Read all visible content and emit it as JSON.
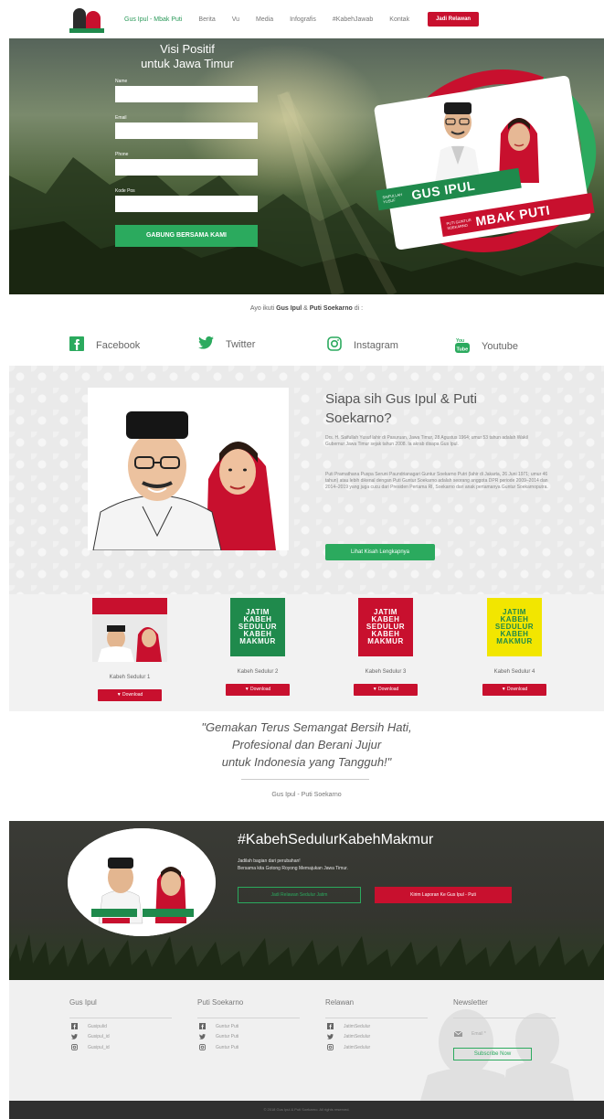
{
  "nav": {
    "brand": "Gus Ipul - Mbak Puti",
    "links": [
      "Berita",
      "Vu",
      "Media",
      "Infografis",
      "#KabehJawab",
      "Kontak"
    ],
    "cta": "Jadi Relawan"
  },
  "hero": {
    "title_line1": "Visi Positif",
    "title_line2": "untuk Jawa Timur",
    "form": {
      "name_label": "Name",
      "email_label": "Email",
      "phone_label": "Phone",
      "zip_label": "Kode Pos",
      "submit": "GABUNG BERSAMA KAMI"
    },
    "campaign": {
      "badge1_small": "SAIFULLAH YUSUF",
      "badge1_big": "GUS IPUL",
      "badge2_small": "PUTI GUNTUR SOEKARNO",
      "badge2_big": "MBAK PUTI"
    }
  },
  "follow": {
    "prefix": "Ayo ikuti",
    "name1": "Gus Ipul",
    "amp": "&",
    "name2": "Puti Soekarno",
    "suffix": "di :",
    "networks": [
      {
        "label": "Facebook",
        "icon": "facebook-icon"
      },
      {
        "label": "Twitter",
        "icon": "twitter-icon"
      },
      {
        "label": "Instagram",
        "icon": "instagram-icon"
      },
      {
        "label": "Youtube",
        "icon": "youtube-icon"
      }
    ]
  },
  "about": {
    "title": "Siapa sih Gus Ipul & Puti Soekarno?",
    "p1": "Drs. H. Saifullah Yusuf lahir di Pasuruan, Jawa Timur, 28 Agustus 1964; umur 53 tahun adalah Wakil Gubernur Jawa Timur sejak tahun 2008. Ia akrab disapa Gus Ipul.",
    "p2": "Puti Pramathana Puspa Seruni Paundrianagari Guntur Soekarno Putri (lahir di Jakarta, 26 Juni 1971; umur 46 tahun) atau lebih dikenal dengan Puti Guntur Soekarno adalah seorang anggota DPR periode 2009–2014 dan 2014–2019 yang juga cucu dari Presiden Pertama RI, Soekarno dari anak pertamanya Guntur Soekarnoputra.",
    "button": "Lihat Kisah Lengkapnya"
  },
  "downloads": {
    "items": [
      {
        "title": "Kabeh Sedulur 1",
        "poster_lines": []
      },
      {
        "title": "Kabeh Sedulur 2",
        "poster_lines": [
          "JATIM",
          "KABEH",
          "SEDULUR",
          "KABEH",
          "MAKMUR"
        ]
      },
      {
        "title": "Kabeh Sedulur 3",
        "poster_lines": [
          "JATIM",
          "KABEH",
          "SEDULUR",
          "KABEH",
          "MAKMUR"
        ]
      },
      {
        "title": "Kabeh Sedulur 4",
        "poster_lines": [
          "JATIM",
          "KABEH",
          "SEDULUR",
          "KABEH",
          "MAKMUR"
        ]
      }
    ],
    "button": "Download"
  },
  "quote": {
    "line1": "\"Gemakan Terus Semangat Bersih Hati,",
    "line2": "Profesional dan Berani Jujur",
    "line3": "untuk Indonesia yang Tangguh!\"",
    "author": "Gus Ipul - Puti Soekarno"
  },
  "band": {
    "title": "#KabehSedulurKabehMakmur",
    "p1": "Jadilah bagian dari perubahan!",
    "p2": "Bersama kita Gotong Royong Memajukan Jawa Timur.",
    "btn1": "Jadi Relawan Sedulur Jatim",
    "btn2": "Kirim Laporan Ke Gus Ipul - Puti"
  },
  "footer": {
    "cols": [
      {
        "head": "Gus Ipul",
        "items": [
          "Gusipulid",
          "Gusipul_id",
          "Gusipul_id"
        ]
      },
      {
        "head": "Puti Soekarno",
        "items": [
          "Guntur Puti",
          "Guntur Puti",
          "Guntur Puti"
        ]
      },
      {
        "head": "Relawan",
        "items": [
          "JatimSedulur",
          "JatimSedulur",
          "JatimSedulur"
        ]
      }
    ],
    "newsletter": {
      "head": "Newsletter",
      "email_placeholder": "Email *",
      "button": "Subscribe Now"
    },
    "copyright": "© 2018 Gus Ipul & Puti Soekarno. All rights reserved."
  },
  "colors": {
    "primary_green": "#2baa5e",
    "primary_red": "#c8102e",
    "dark_band": "#34352f"
  }
}
